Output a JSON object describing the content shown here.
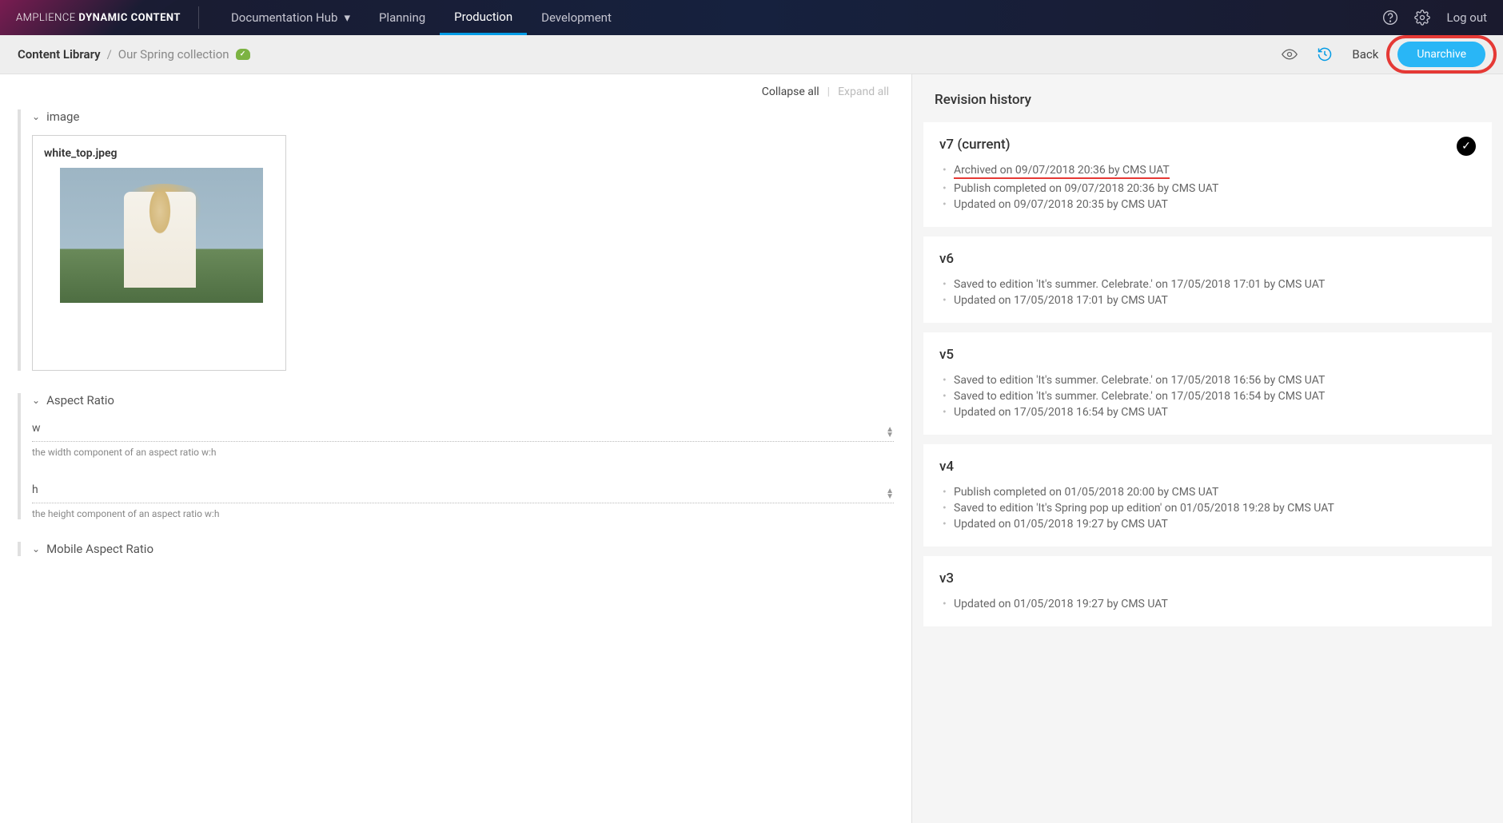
{
  "brand": {
    "light": "AMPLIENCE",
    "bold": "DYNAMIC CONTENT"
  },
  "nav": {
    "docHub": "Documentation Hub",
    "planning": "Planning",
    "production": "Production",
    "development": "Development",
    "logout": "Log out"
  },
  "breadcrumb": {
    "root": "Content Library",
    "sep": "/",
    "leaf": "Our Spring collection"
  },
  "subheader": {
    "back": "Back",
    "unarchive": "Unarchive"
  },
  "paneActions": {
    "collapse": "Collapse all",
    "expand": "Expand all"
  },
  "sections": {
    "image": "image",
    "aspect": "Aspect Ratio",
    "mobileAspect": "Mobile Aspect Ratio"
  },
  "imageCard": {
    "filename": "white_top.jpeg"
  },
  "fields": {
    "w": {
      "label": "w",
      "hint": "the width component of an aspect ratio w:h"
    },
    "h": {
      "label": "h",
      "hint": "the height component of an aspect ratio w:h"
    }
  },
  "revision": {
    "title": "Revision history",
    "items": [
      {
        "version": "v7 (current)",
        "current": true,
        "entries": [
          {
            "text": "Archived on 09/07/2018 20:36 by CMS UAT",
            "underline": true
          },
          {
            "text": "Publish completed on 09/07/2018 20:36 by CMS UAT"
          },
          {
            "text": "Updated on 09/07/2018 20:35 by CMS UAT"
          }
        ]
      },
      {
        "version": "v6",
        "entries": [
          {
            "text": "Saved to edition 'It's summer. Celebrate.' on 17/05/2018 17:01 by CMS UAT"
          },
          {
            "text": "Updated on 17/05/2018 17:01 by CMS UAT"
          }
        ]
      },
      {
        "version": "v5",
        "entries": [
          {
            "text": "Saved to edition 'It's summer. Celebrate.' on 17/05/2018 16:56 by CMS UAT"
          },
          {
            "text": "Saved to edition 'It's summer. Celebrate.' on 17/05/2018 16:54 by CMS UAT"
          },
          {
            "text": "Updated on 17/05/2018 16:54 by CMS UAT"
          }
        ]
      },
      {
        "version": "v4",
        "entries": [
          {
            "text": "Publish completed on 01/05/2018 20:00 by CMS UAT"
          },
          {
            "text": "Saved to edition 'It's Spring pop up edition' on 01/05/2018 19:28 by CMS UAT"
          },
          {
            "text": "Updated on 01/05/2018 19:27 by CMS UAT"
          }
        ]
      },
      {
        "version": "v3",
        "entries": [
          {
            "text": "Updated on 01/05/2018 19:27 by CMS UAT"
          }
        ]
      }
    ]
  }
}
